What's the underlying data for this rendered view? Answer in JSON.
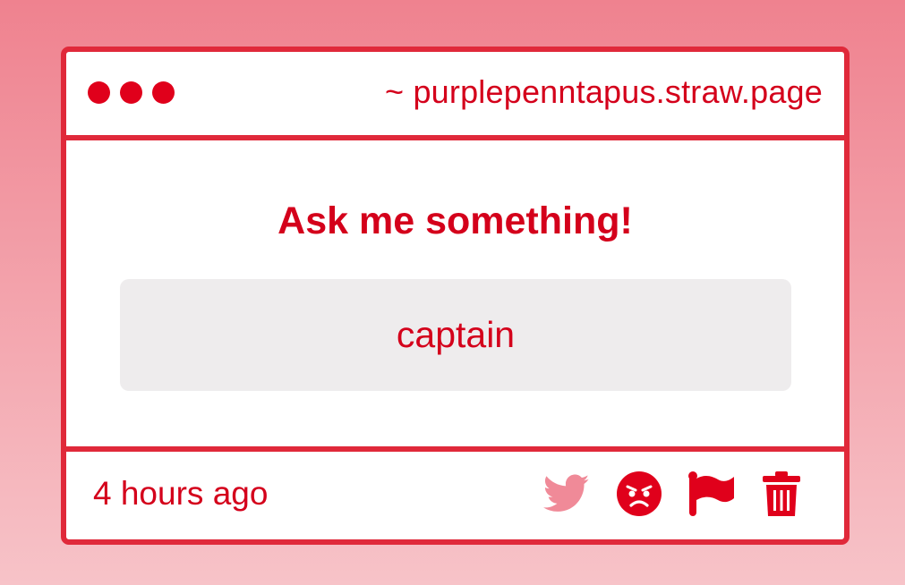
{
  "window": {
    "url": "~ purplepenntapus.straw.page"
  },
  "content": {
    "heading": "Ask me something!",
    "answer": "captain"
  },
  "footer": {
    "timestamp": "4 hours ago",
    "actions": [
      {
        "icon": "twitter-icon",
        "color": "#f08a98"
      },
      {
        "icon": "angry-face-icon",
        "color": "#e0001b"
      },
      {
        "icon": "flag-icon",
        "color": "#e0001b"
      },
      {
        "icon": "trash-icon",
        "color": "#e0001b"
      }
    ]
  },
  "colors": {
    "accent": "#e0001b",
    "border": "#e0293a",
    "answer_background": "#eeeced",
    "background_top": "#ef828f",
    "background_bottom": "#f7c3c8"
  }
}
